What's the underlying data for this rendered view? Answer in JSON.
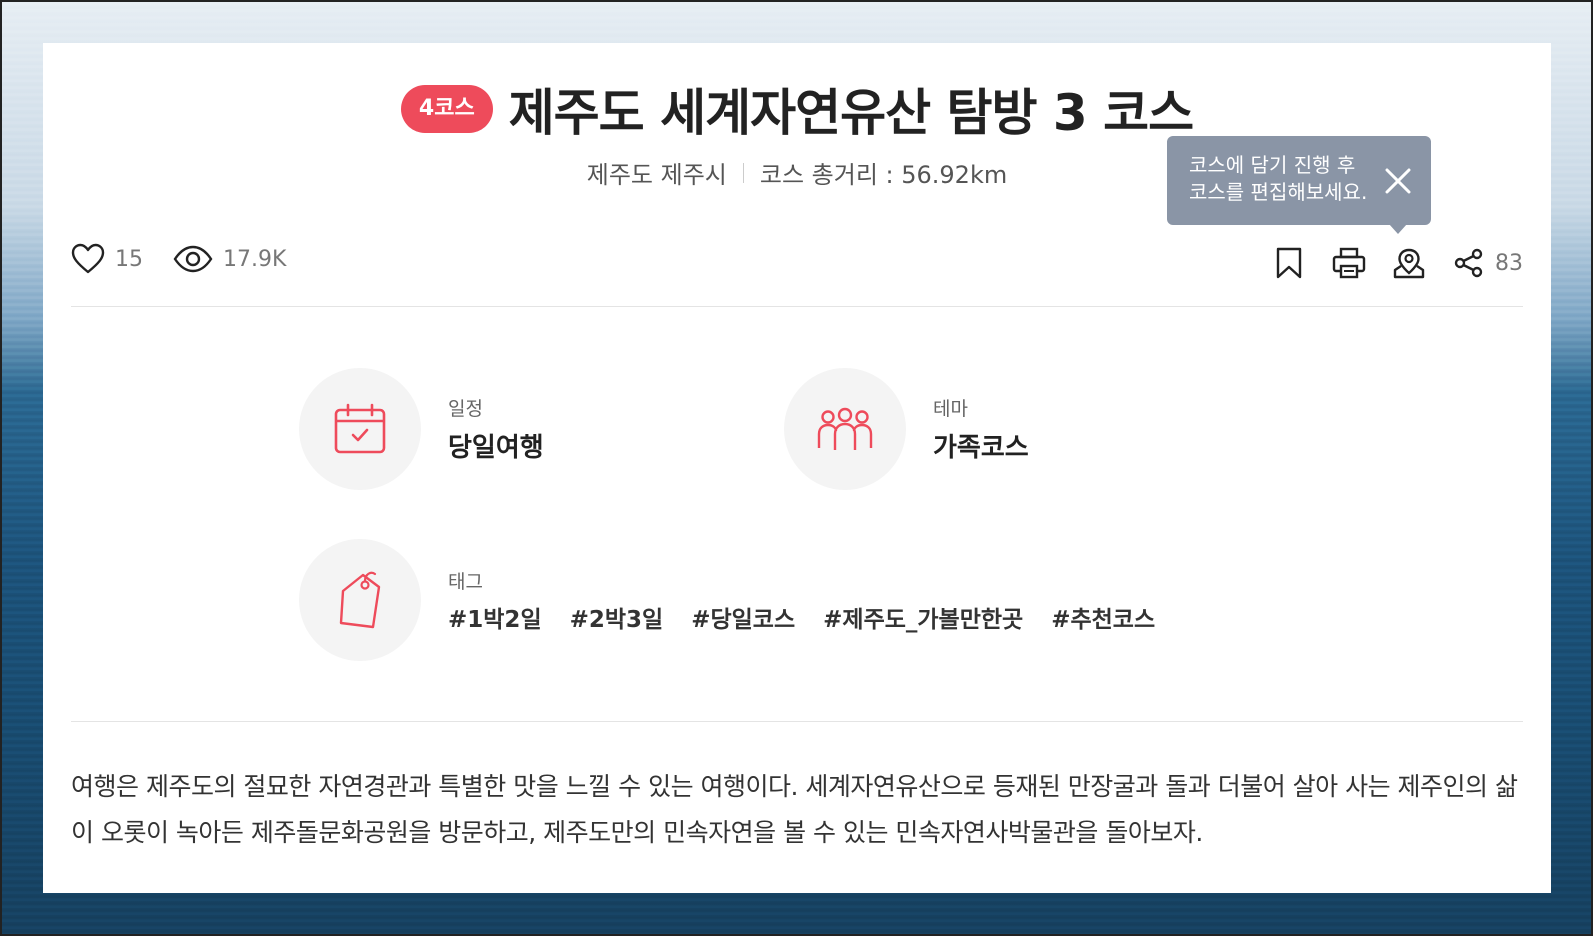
{
  "course": {
    "badge": "4코스",
    "title": "제주도 세계자연유산 탐방 3 코스",
    "region": "제주도 제주시",
    "distance": "코스 총거리 : 56.92km"
  },
  "tooltip": {
    "line1": "코스에 담기 진행 후",
    "line2": "코스를 편집해보세요."
  },
  "stats": {
    "likes": "15",
    "views": "17.9K",
    "shares": "83"
  },
  "info": {
    "schedule_label": "일정",
    "schedule_value": "당일여행",
    "theme_label": "테마",
    "theme_value": "가족코스",
    "tags_label": "태그",
    "tags": [
      "#1박2일",
      "#2박3일",
      "#당일코스",
      "#제주도_가볼만한곳",
      "#추천코스"
    ]
  },
  "description": "여행은 제주도의 절묘한 자연경관과 특별한 맛을 느낄 수 있는 여행이다. 세계자연유산으로 등재된 만장굴과 돌과 더불어 살아 사는 제주인의 삶이 오롯이 녹아든 제주돌문화공원을 방문하고, 제주도만의 민속자연을 볼 수 있는 민속자연사박물관을 돌아보자.",
  "colors": {
    "accent": "#ee4b5b",
    "tooltip": "#8a95a6",
    "icon_circle": "#f4f4f4"
  },
  "icons": [
    "heart-icon",
    "eye-icon",
    "bookmark-icon",
    "print-icon",
    "map-pin-icon",
    "share-icon",
    "close-icon",
    "calendar-icon",
    "people-icon",
    "tag-icon"
  ]
}
